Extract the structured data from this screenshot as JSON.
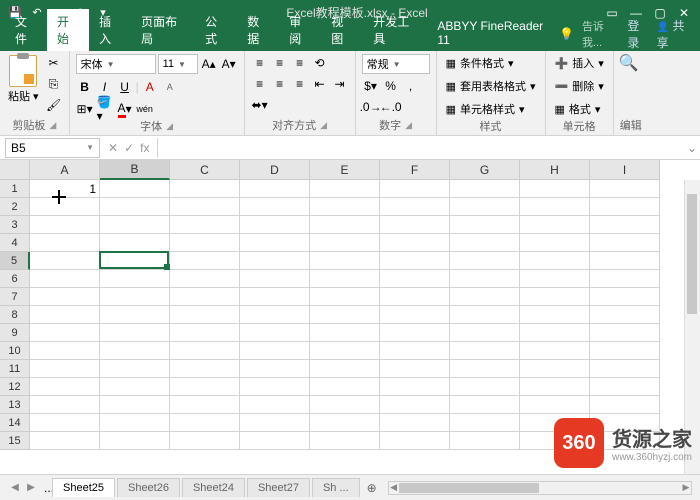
{
  "titlebar": {
    "title": "Excel教程模板.xlsx - Excel",
    "qat_save": "💾",
    "qat_undo": "↶",
    "qat_redo": "↷"
  },
  "tabs": {
    "file": "文件",
    "home": "开始",
    "insert": "插入",
    "layout": "页面布局",
    "formulas": "公式",
    "data": "数据",
    "review": "审阅",
    "view": "视图",
    "dev": "开发工具",
    "abbyy": "ABBYY FineReader 11",
    "tell": "告诉我...",
    "login": "登录",
    "share": "共享"
  },
  "ribbon": {
    "clipboard": {
      "paste": "粘贴",
      "label": "剪贴板"
    },
    "font": {
      "name": "宋体",
      "size": "11",
      "bold": "B",
      "italic": "I",
      "underline": "U",
      "grow": "A",
      "shrink": "A",
      "phonetic": "wén",
      "label": "字体"
    },
    "align": {
      "label": "对齐方式",
      "wrap": "自动换行",
      "merge": "合并后居中"
    },
    "number": {
      "format": "常规",
      "label": "数字"
    },
    "styles": {
      "cond": "条件格式",
      "table": "套用表格格式",
      "cell": "单元格样式",
      "label": "样式"
    },
    "cells": {
      "insert": "插入",
      "delete": "删除",
      "format": "格式",
      "label": "单元格"
    },
    "editing": {
      "label": "编辑"
    }
  },
  "namebox": {
    "ref": "B5",
    "fx": "fx"
  },
  "grid": {
    "cols": [
      "A",
      "B",
      "C",
      "D",
      "E",
      "F",
      "G",
      "H",
      "I"
    ],
    "rows": [
      "1",
      "2",
      "3",
      "4",
      "5",
      "6",
      "7",
      "8",
      "9",
      "10",
      "11",
      "12",
      "13",
      "14",
      "15"
    ],
    "a1": "1",
    "active": "B5"
  },
  "sheets": {
    "tabs": [
      "Sheet25",
      "Sheet26",
      "Sheet24",
      "Sheet27",
      "Sh"
    ],
    "ellipsis": "..."
  },
  "watermark": {
    "badge": "360",
    "title": "货源之家",
    "url": "www.360hyzj.com"
  }
}
